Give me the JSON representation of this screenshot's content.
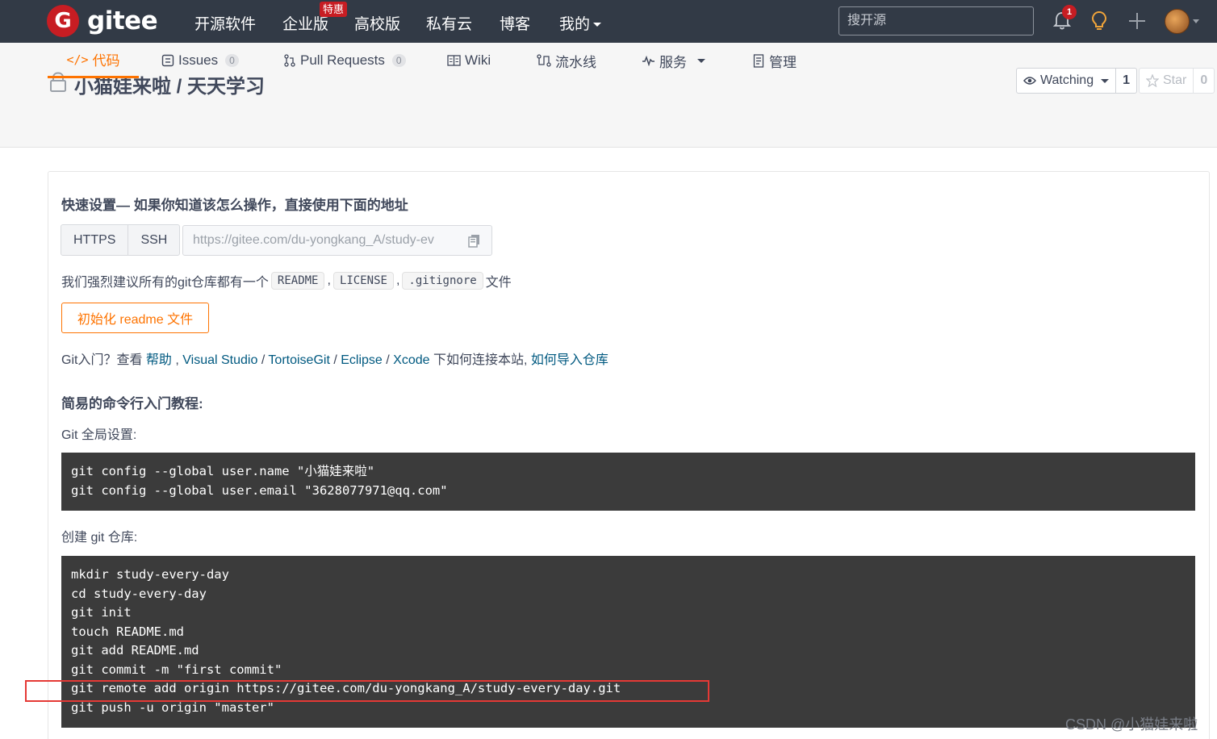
{
  "topnav": {
    "logo_letter": "G",
    "logo_text": "gitee",
    "items": [
      "开源软件",
      "企业版",
      "高校版",
      "私有云",
      "博客",
      "我的"
    ],
    "enterprise_badge": "特惠",
    "search_placeholder": "搜开源",
    "notification_count": "1",
    "icons": [
      "bell-icon",
      "lightbulb-icon",
      "plus-icon",
      "avatar"
    ]
  },
  "repo": {
    "owner": "小猫娃来啦",
    "separator": " / ",
    "name": "天天学习",
    "watch_label": "Watching",
    "watch_count": "1",
    "star_label": "Star",
    "star_count": "0",
    "tabs": [
      {
        "label": "代码",
        "icon": "code-icon"
      },
      {
        "label": "Issues",
        "count": "0",
        "icon": "issues-icon"
      },
      {
        "label": "Pull Requests",
        "count": "0",
        "icon": "pull-request-icon"
      },
      {
        "label": "Wiki",
        "icon": "wiki-icon"
      },
      {
        "label": "流水线",
        "icon": "pipeline-icon"
      },
      {
        "label": "服务",
        "icon": "service-icon"
      },
      {
        "label": "管理",
        "icon": "manage-icon"
      }
    ]
  },
  "quick_setup": {
    "title": "快速设置— 如果你知道该怎么操作，直接使用下面的地址",
    "protocols": [
      "HTTPS",
      "SSH"
    ],
    "url": "https://gitee.com/du-yongkang_A/study-ev",
    "recommend_prefix": "我们强烈建议所有的git仓库都有一个",
    "recommend_files": [
      "README",
      "LICENSE",
      ".gitignore"
    ],
    "recommend_sep": ",",
    "recommend_suffix": "文件",
    "init_button": "初始化 readme 文件",
    "help_prefix": "Git入门？查看 ",
    "help_links": [
      "帮助",
      "Visual Studio",
      "TortoiseGit",
      "Eclipse",
      "Xcode"
    ],
    "help_sep1": " , ",
    "help_sep": " / ",
    "help_mid": " 下如何连接本站, ",
    "help_import": "如何导入仓库"
  },
  "tutorial": {
    "title": "简易的命令行入门教程:",
    "global_label": "Git 全局设置:",
    "global_cmds": [
      "git config --global user.name \"小猫娃来啦\"",
      "git config --global user.email \"3628077971@qq.com\""
    ],
    "create_label": "创建 git 仓库:",
    "create_cmds": [
      "mkdir study-every-day",
      "cd study-every-day",
      "git init",
      "touch README.md",
      "git add README.md",
      "git commit -m \"first commit\"",
      "git remote add origin https://gitee.com/du-yongkang_A/study-every-day.git",
      "git push -u origin \"master\""
    ]
  },
  "watermark": "CSDN @小猫娃来啦",
  "colors": {
    "accent": "#fe7300",
    "brand": "#c71d23",
    "nav_bg": "#323a46",
    "link": "#005980",
    "highlight": "#e53935"
  }
}
